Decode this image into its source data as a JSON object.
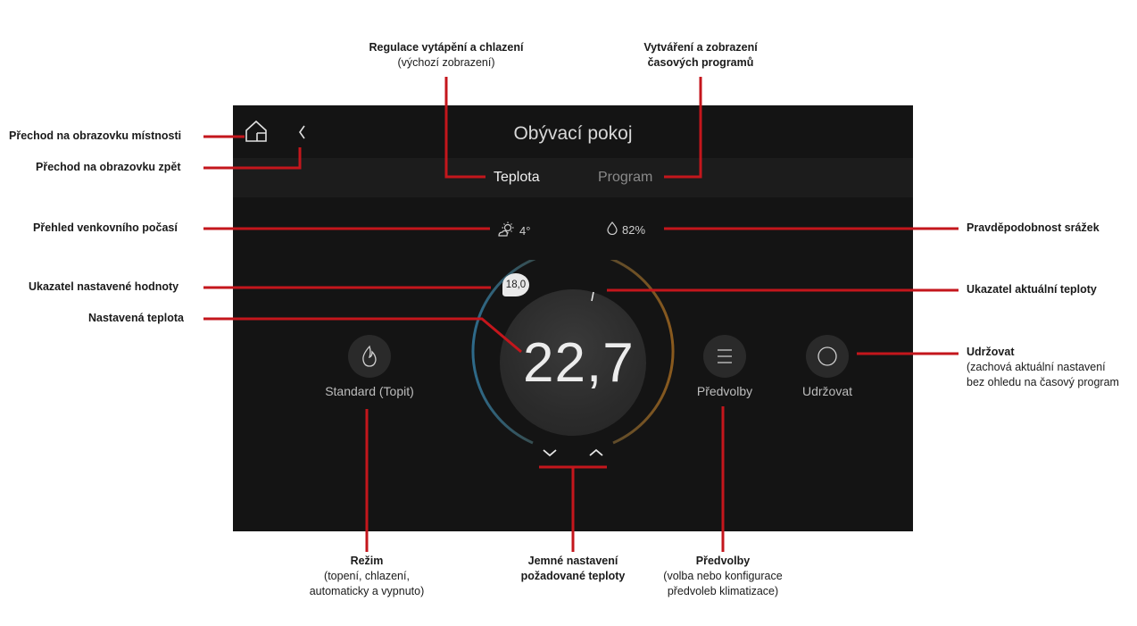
{
  "screen": {
    "title": "Obývací pokoj",
    "tabs": [
      {
        "label": "Teplota",
        "active": true
      },
      {
        "label": "Program",
        "active": false
      }
    ],
    "weather": {
      "temperature": "4°",
      "precipitation": "82%"
    },
    "setpoint_badge": "18,0",
    "set_temperature": "22,7",
    "mode": {
      "label": "Standard (Topit)",
      "icon": "flame-icon"
    },
    "presets": {
      "label": "Předvolby",
      "icon": "menu-icon"
    },
    "hold": {
      "label": "Udržovat",
      "icon": "circle-icon"
    },
    "colors": {
      "background": "#141414",
      "tabbar": "#1c1c1c",
      "cold": "#2e6a8a",
      "warm": "#8a5a1e",
      "leader": "#c4161c"
    }
  },
  "annotations": {
    "room_screen": "Přechod na obrazovku místnosti",
    "back_screen": "Přechod na obrazovku zpět",
    "heating_control_title": "Regulace vytápění a chlazení",
    "heating_control_sub": "(výchozí zobrazení)",
    "programs_line1": "Vytváření a zobrazení",
    "programs_line2": "časových programů",
    "weather_overview": "Přehled venkovního počasí",
    "precip_probability": "Pravděpodobnost srážek",
    "setpoint_indicator": "Ukazatel nastavené hodnoty",
    "current_temp_indicator": "Ukazatel aktuální teploty",
    "set_temperature": "Nastavená teplota",
    "hold_title": "Udržovat",
    "hold_line1": "(zachová aktuální nastavení",
    "hold_line2": "bez ohledu na časový program",
    "mode_title": "Režim",
    "mode_line1": "(topení, chlazení,",
    "mode_line2": "automaticky a vypnuto)",
    "fine_line1": "Jemné nastavení",
    "fine_line2": "požadované teploty",
    "presets_title": "Předvolby",
    "presets_line1": "(volba nebo konfigurace",
    "presets_line2": "předvoleb klimatizace)"
  }
}
